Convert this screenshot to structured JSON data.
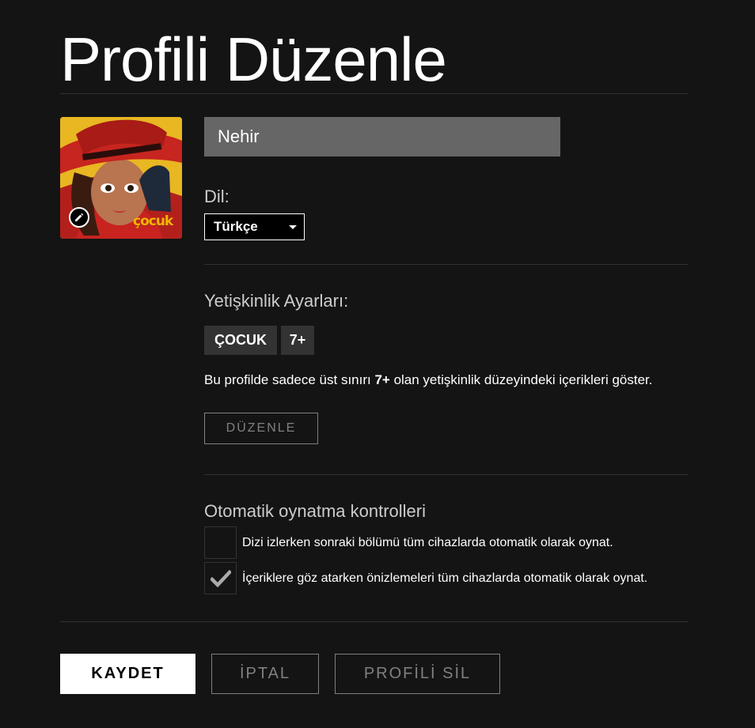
{
  "page": {
    "title": "Profili Düzenle"
  },
  "profile": {
    "name_value": "Nehir",
    "kids_badge": "çocuk",
    "avatar_edit_icon": "pencil-icon"
  },
  "language": {
    "label": "Dil:",
    "selected": "Türkçe"
  },
  "maturity": {
    "heading": "Yetişkinlik Ayarları:",
    "pills": [
      "ÇOCUK",
      "7+"
    ],
    "description_before": "Bu profilde sadece üst sınırı ",
    "description_bold": "7+",
    "description_after": " olan yetişkinlik düzeyindeki içerikleri göster.",
    "edit_button": "DÜZENLE"
  },
  "autoplay": {
    "heading": "Otomatik oynatma kontrolleri",
    "options": [
      {
        "label": "Dizi izlerken sonraki bölümü tüm cihazlarda otomatik olarak oynat.",
        "checked": false
      },
      {
        "label": "İçeriklere göz atarken önizlemeleri tüm cihazlarda otomatik olarak oynat.",
        "checked": true
      }
    ]
  },
  "actions": {
    "save": "KAYDET",
    "cancel": "İPTAL",
    "delete": "PROFİLİ SİL"
  },
  "colors": {
    "background": "#141414",
    "input_bg": "#666666",
    "pill_bg": "#333333",
    "muted": "#808080"
  }
}
